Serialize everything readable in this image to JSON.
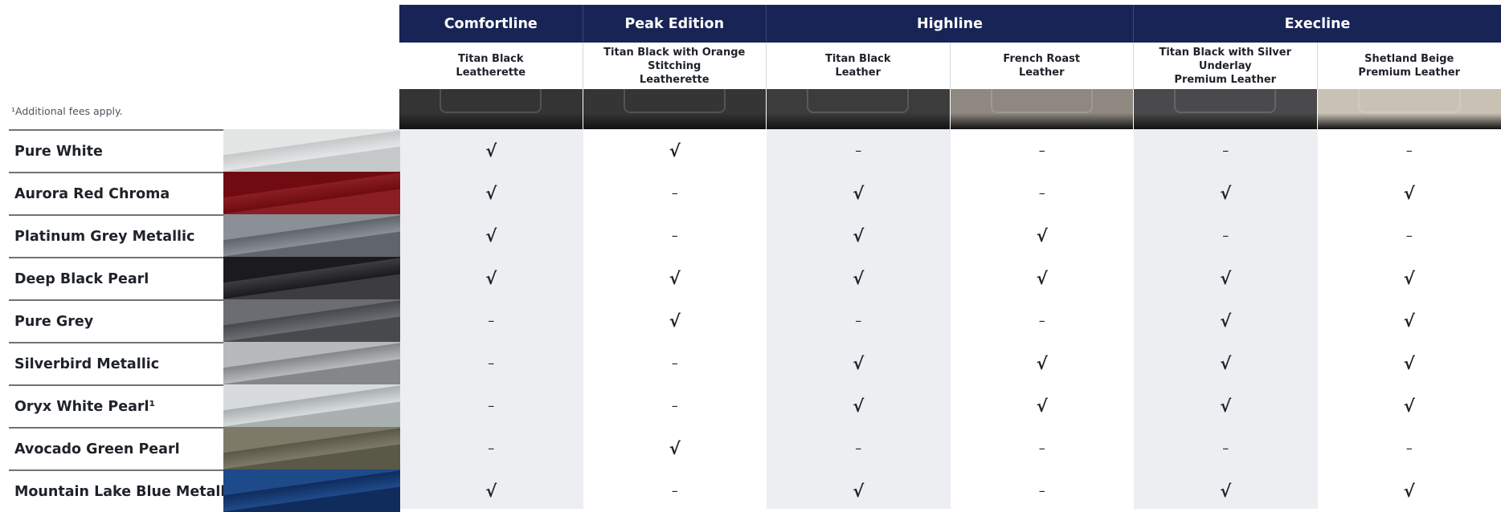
{
  "trims": [
    {
      "name": "Comfortline",
      "span": 1
    },
    {
      "name": "Peak Edition",
      "span": 1
    },
    {
      "name": "Highline",
      "span": 2
    },
    {
      "name": "Execline",
      "span": 2
    }
  ],
  "interiors": [
    {
      "name": "Titan Black\nLeatherette",
      "color": "#343434"
    },
    {
      "name": "Titan Black with Orange Stitching\nLeatherette",
      "color": "#353535"
    },
    {
      "name": "Titan Black\nLeather",
      "color": "#3c3c3c"
    },
    {
      "name": "French Roast\nLeather",
      "color": "#8e8881"
    },
    {
      "name": "Titan Black with Silver Underlay\nPremium Leather",
      "color": "#4a4a4c"
    },
    {
      "name": "Shetland Beige\nPremium Leather",
      "color": "#c9c2b4"
    }
  ],
  "footnote": "¹Additional fees apply.",
  "available_symbol": "√",
  "unavailable_symbol": "–",
  "colors": [
    {
      "name": "Pure White",
      "swatch": [
        "#e4e6e6",
        "#c4c8c9"
      ],
      "avail": [
        true,
        true,
        false,
        false,
        false,
        false
      ]
    },
    {
      "name": "Aurora Red Chroma",
      "swatch": [
        "#6f0b11",
        "#8a1e24"
      ],
      "avail": [
        true,
        false,
        true,
        false,
        true,
        true
      ]
    },
    {
      "name": "Platinum Grey Metallic",
      "swatch": [
        "#8a9096",
        "#5f656b"
      ],
      "avail": [
        true,
        false,
        true,
        true,
        false,
        false
      ]
    },
    {
      "name": "Deep Black Pearl",
      "swatch": [
        "#1b1b1d",
        "#3d3d40"
      ],
      "avail": [
        true,
        true,
        true,
        true,
        true,
        true
      ]
    },
    {
      "name": "Pure Grey",
      "swatch": [
        "#6a6d71",
        "#47494d"
      ],
      "avail": [
        false,
        true,
        false,
        false,
        true,
        true
      ]
    },
    {
      "name": "Silverbird Metallic",
      "swatch": [
        "#b8b9bb",
        "#858689"
      ],
      "avail": [
        false,
        false,
        true,
        true,
        true,
        true
      ]
    },
    {
      "name": "Oryx White Pearl¹",
      "swatch": [
        "#d7dbdb",
        "#a9b0b2"
      ],
      "avail": [
        false,
        false,
        true,
        true,
        true,
        true
      ]
    },
    {
      "name": "Avocado Green Pearl",
      "swatch": [
        "#7d7a68",
        "#5a5847"
      ],
      "avail": [
        false,
        true,
        false,
        false,
        false,
        false
      ]
    },
    {
      "name": "Mountain Lake Blue Metallic",
      "swatch": [
        "#1f4a8a",
        "#0f2c5c"
      ],
      "avail": [
        true,
        false,
        true,
        false,
        true,
        true
      ]
    }
  ],
  "colors_theme": {
    "header_bg": "#192456",
    "shaded_column": "#eceef1",
    "white_column": "#ffffff"
  }
}
